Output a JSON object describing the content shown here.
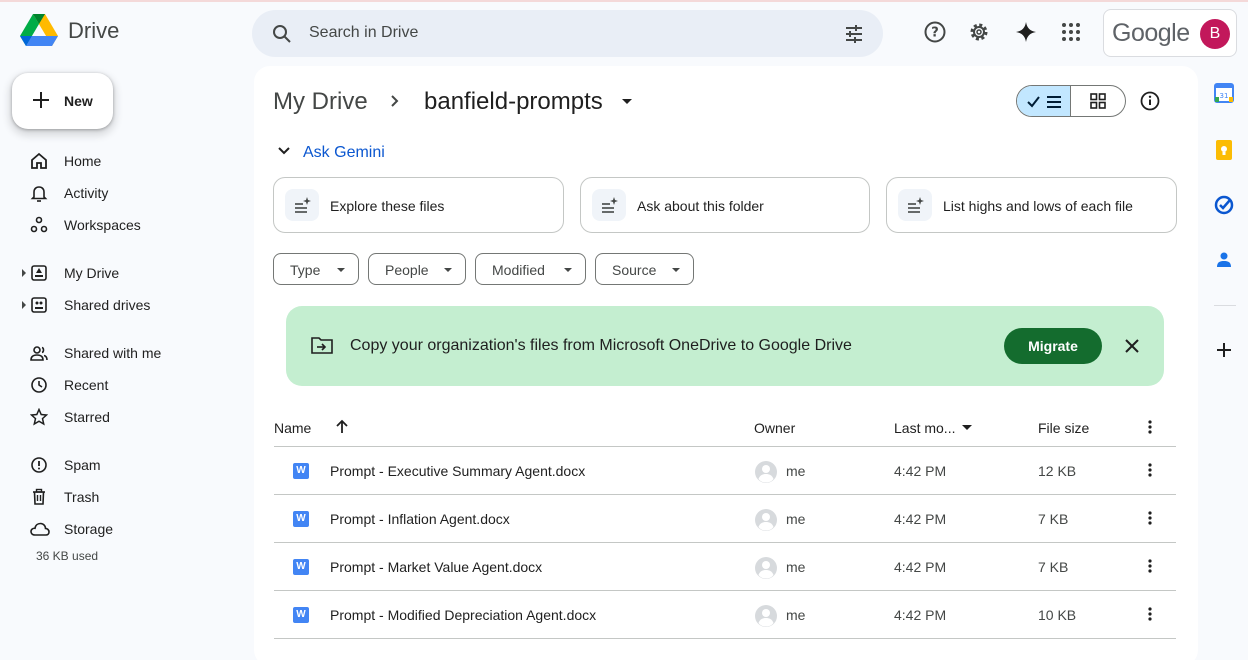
{
  "app": {
    "name": "Drive"
  },
  "search": {
    "placeholder": "Search in Drive"
  },
  "account": {
    "brand": "Google",
    "avatar_letter": "B"
  },
  "sidebar": {
    "new_label": "New",
    "items": [
      {
        "label": "Home",
        "icon": "home-icon"
      },
      {
        "label": "Activity",
        "icon": "bell-icon"
      },
      {
        "label": "Workspaces",
        "icon": "workspaces-icon"
      },
      {
        "label": "My Drive",
        "icon": "my-drive-icon"
      },
      {
        "label": "Shared drives",
        "icon": "shared-drives-icon"
      },
      {
        "label": "Shared with me",
        "icon": "people-icon"
      },
      {
        "label": "Recent",
        "icon": "clock-icon"
      },
      {
        "label": "Starred",
        "icon": "star-icon"
      },
      {
        "label": "Spam",
        "icon": "spam-icon"
      },
      {
        "label": "Trash",
        "icon": "trash-icon"
      },
      {
        "label": "Storage",
        "icon": "cloud-icon"
      }
    ],
    "storage_used": "36 KB used"
  },
  "breadcrumb": {
    "root": "My Drive",
    "current": "banfield-prompts"
  },
  "gemini": {
    "label": "Ask Gemini",
    "suggestions": [
      "Explore these files",
      "Ask about this folder",
      "List highs and lows of each file"
    ]
  },
  "filters": [
    "Type",
    "People",
    "Modified",
    "Source"
  ],
  "banner": {
    "text": "Copy your organization's files from Microsoft OneDrive to Google Drive",
    "button": "Migrate"
  },
  "table": {
    "headers": {
      "name": "Name",
      "owner": "Owner",
      "modified": "Last mo...",
      "size": "File size"
    },
    "rows": [
      {
        "name": "Prompt - Executive Summary Agent.docx",
        "owner": "me",
        "modified": "4:42 PM",
        "size": "12 KB"
      },
      {
        "name": "Prompt - Inflation Agent.docx",
        "owner": "me",
        "modified": "4:42 PM",
        "size": "7 KB"
      },
      {
        "name": "Prompt - Market Value Agent.docx",
        "owner": "me",
        "modified": "4:42 PM",
        "size": "7 KB"
      },
      {
        "name": "Prompt - Modified Depreciation Agent.docx",
        "owner": "me",
        "modified": "4:42 PM",
        "size": "10 KB"
      }
    ]
  },
  "colors": {
    "accent": "#0b57d0",
    "banner_bg": "#c4eed0",
    "migrate_bg": "#146c2e",
    "avatar_bg": "#c2185b"
  }
}
